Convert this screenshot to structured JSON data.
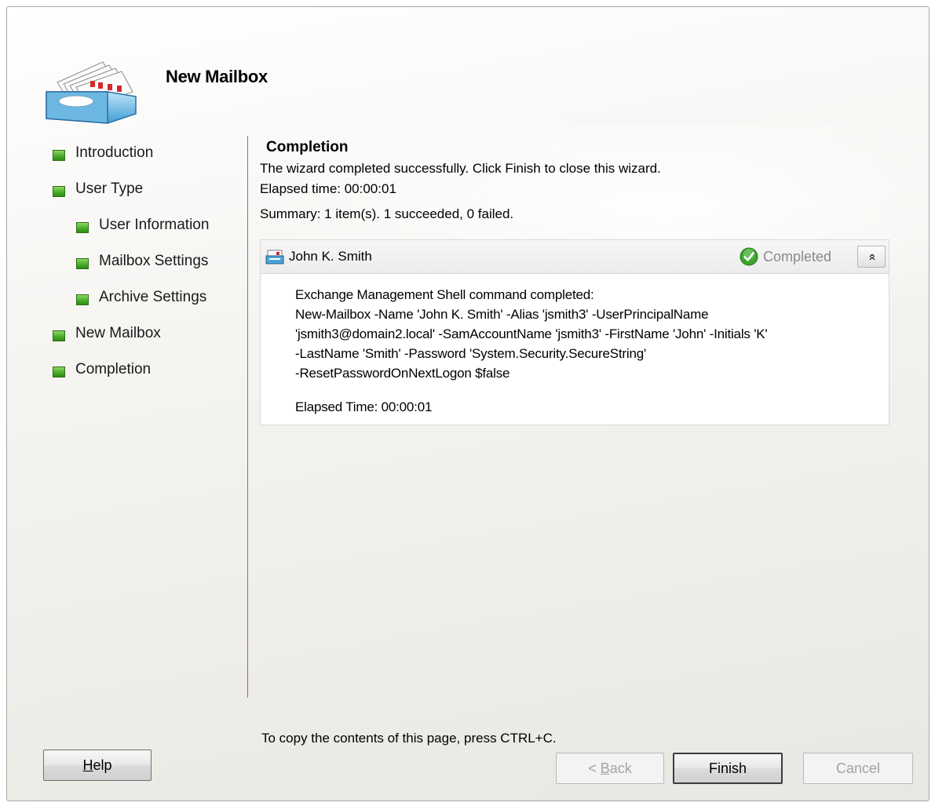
{
  "wizard": {
    "title": "New Mailbox"
  },
  "nav": {
    "items": [
      {
        "label": "Introduction",
        "sub": false
      },
      {
        "label": "User Type",
        "sub": false
      },
      {
        "label": "User Information",
        "sub": true
      },
      {
        "label": "Mailbox Settings",
        "sub": true
      },
      {
        "label": "Archive Settings",
        "sub": true
      },
      {
        "label": "New Mailbox",
        "sub": false
      },
      {
        "label": "Completion",
        "sub": false
      }
    ]
  },
  "completion": {
    "heading": "Completion",
    "message": "The wizard completed successfully. Click Finish to close this wizard.",
    "elapsed": "Elapsed time: 00:00:01",
    "summary": "Summary: 1 item(s). 1 succeeded, 0 failed."
  },
  "result": {
    "name": "John K. Smith",
    "status": "Completed",
    "body_lines": [
      "Exchange Management Shell command completed:",
      "New-Mailbox -Name 'John K. Smith' -Alias 'jsmith3' -UserPrincipalName",
      "'jsmith3@domain2.local' -SamAccountName 'jsmith3' -FirstName 'John' -Initials 'K'",
      "-LastName 'Smith' -Password 'System.Security.SecureString'",
      "-ResetPasswordOnNextLogon $false"
    ],
    "elapsed": "Elapsed Time: 00:00:01"
  },
  "copy_hint": "To copy the contents of this page, press CTRL+C.",
  "buttons": {
    "help_accel": "H",
    "help_rest": "elp",
    "back_prefix": "< ",
    "back_accel": "B",
    "back_rest": "ack",
    "finish": "Finish",
    "cancel": "Cancel"
  },
  "icons": {
    "logo": "mailbox-stack-icon",
    "result": "mailbox-icon",
    "status": "check-circle-icon",
    "collapse": "double-chevron-up-icon",
    "nav_bullet": "green-square-icon"
  },
  "colors": {
    "nav_bullet": "#4aae2a",
    "status_check": "#3aa52a",
    "status_text": "#8a8a8a",
    "disabled_text": "#a3a3a3"
  }
}
